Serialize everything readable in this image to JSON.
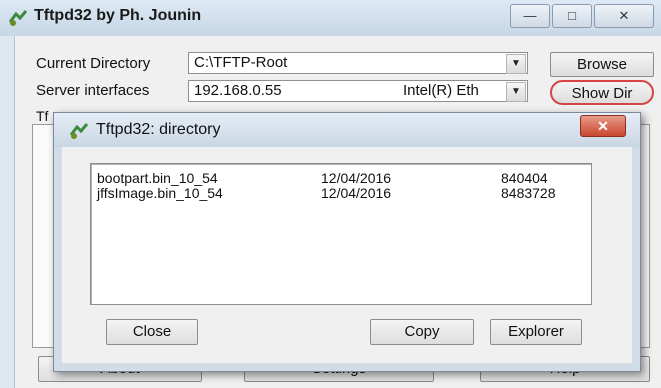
{
  "main_window": {
    "title": "Tftpd32 by Ph. Jounin",
    "controls": {
      "minimize": "—",
      "maximize": "□",
      "close": "✕"
    },
    "current_directory_label": "Current Directory",
    "current_directory_value": "C:\\TFTP-Root",
    "server_interfaces_label": "Server interfaces",
    "server_interface_ip": "192.168.0.55",
    "server_interface_name": "Intel(R) Eth",
    "browse_label": "Browse",
    "show_dir_label": "Show Dir",
    "tab_label_partial": "Tf",
    "bottom_buttons": {
      "about": "About",
      "settings": "Settings",
      "help": "Help"
    },
    "accent_color": "#d64545"
  },
  "dialog": {
    "title": "Tftpd32: directory",
    "close_glyph": "✕",
    "files": [
      {
        "name": "bootpart.bin_10_54",
        "date": "12/04/2016",
        "size": "840404"
      },
      {
        "name": "jffsImage.bin_10_54",
        "date": "12/04/2016",
        "size": "8483728"
      }
    ],
    "buttons": {
      "close": "Close",
      "copy": "Copy",
      "explorer": "Explorer"
    }
  }
}
